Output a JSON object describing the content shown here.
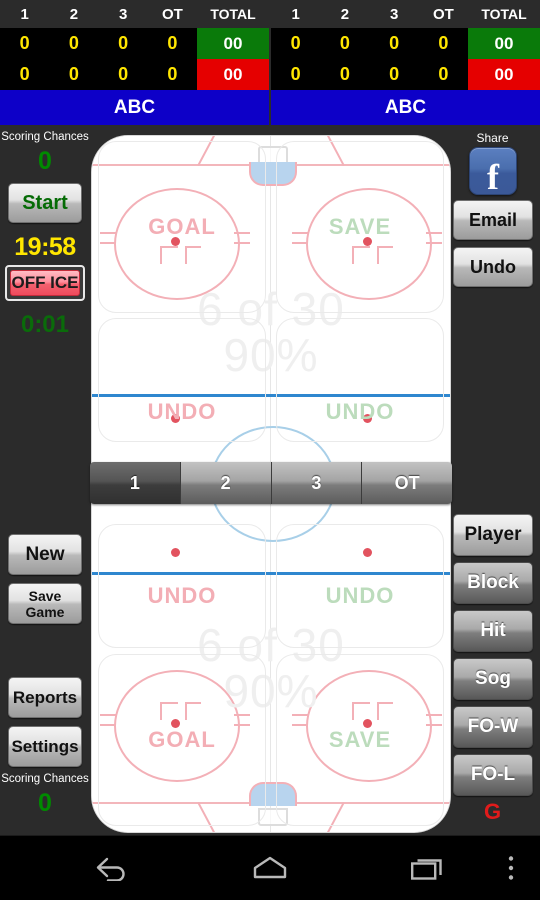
{
  "scoreboard": {
    "columns": [
      "1",
      "2",
      "3",
      "OT",
      "TOTAL"
    ],
    "home": {
      "periods": [
        "0",
        "0",
        "0",
        "0"
      ],
      "total_top": "00",
      "total_bottom": "00",
      "row2_periods": [
        "0",
        "0",
        "0",
        "0"
      ],
      "team": "ABC"
    },
    "away": {
      "periods": [
        "0",
        "0",
        "0",
        "0"
      ],
      "total_top": "00",
      "total_bottom": "00",
      "row2_periods": [
        "0",
        "0",
        "0",
        "0"
      ],
      "team": "ABC"
    },
    "colors": {
      "total_top_bg": "#0a7a0a",
      "total_bottom_bg": "#e50000",
      "team_bg": "#0d00c8",
      "digit": "#ffe600"
    }
  },
  "left_panel": {
    "scoring_chances_label": "Scoring Chances",
    "scoring_chances_value": "0",
    "start_button": "Start",
    "game_clock": "19:58",
    "off_ice_button": "OFF ICE",
    "shift_clock": "0:01",
    "new_button": "New",
    "save_game_button": "Save Game",
    "reports_button": "Reports",
    "settings_button": "Settings",
    "bottom_scoring_chances_label": "Scoring Chances",
    "bottom_scoring_chances_value": "0"
  },
  "right_panel": {
    "share_label": "Share",
    "facebook_icon": "facebook-icon",
    "facebook_glyph": "f",
    "email_button": "Email",
    "undo_button": "Undo",
    "player_button": "Player",
    "block_button": "Block",
    "hit_button": "Hit",
    "sog_button": "Sog",
    "fo_win_button": "FO-W",
    "fo_loss_button": "FO-L",
    "google_logo": "G"
  },
  "rink": {
    "watermark_top_count": "6 of 30",
    "watermark_top_pct": "90%",
    "watermark_bottom_count": "6 of 30",
    "watermark_bottom_pct": "90%",
    "zones": {
      "top_left": "GOAL",
      "top_right": "SAVE",
      "mid_top_left": "UNDO",
      "mid_top_right": "UNDO",
      "mid_bottom_left": "UNDO",
      "mid_bottom_right": "UNDO",
      "bottom_left": "GOAL",
      "bottom_right": "SAVE"
    },
    "colors": {
      "goal_label": "#f3aeb5",
      "save_label": "#bcdcbc",
      "blue_line": "#2f87cf",
      "red_line": "#f3b6bb",
      "crease": "#b8d4ee"
    }
  },
  "periods": {
    "items": [
      "1",
      "2",
      "3",
      "OT"
    ],
    "selected_index": 0
  },
  "navbar": {
    "back_icon": "back-arrow-icon",
    "home_icon": "home-icon",
    "recents_icon": "recent-apps-icon",
    "menu_icon": "overflow-menu-icon"
  }
}
